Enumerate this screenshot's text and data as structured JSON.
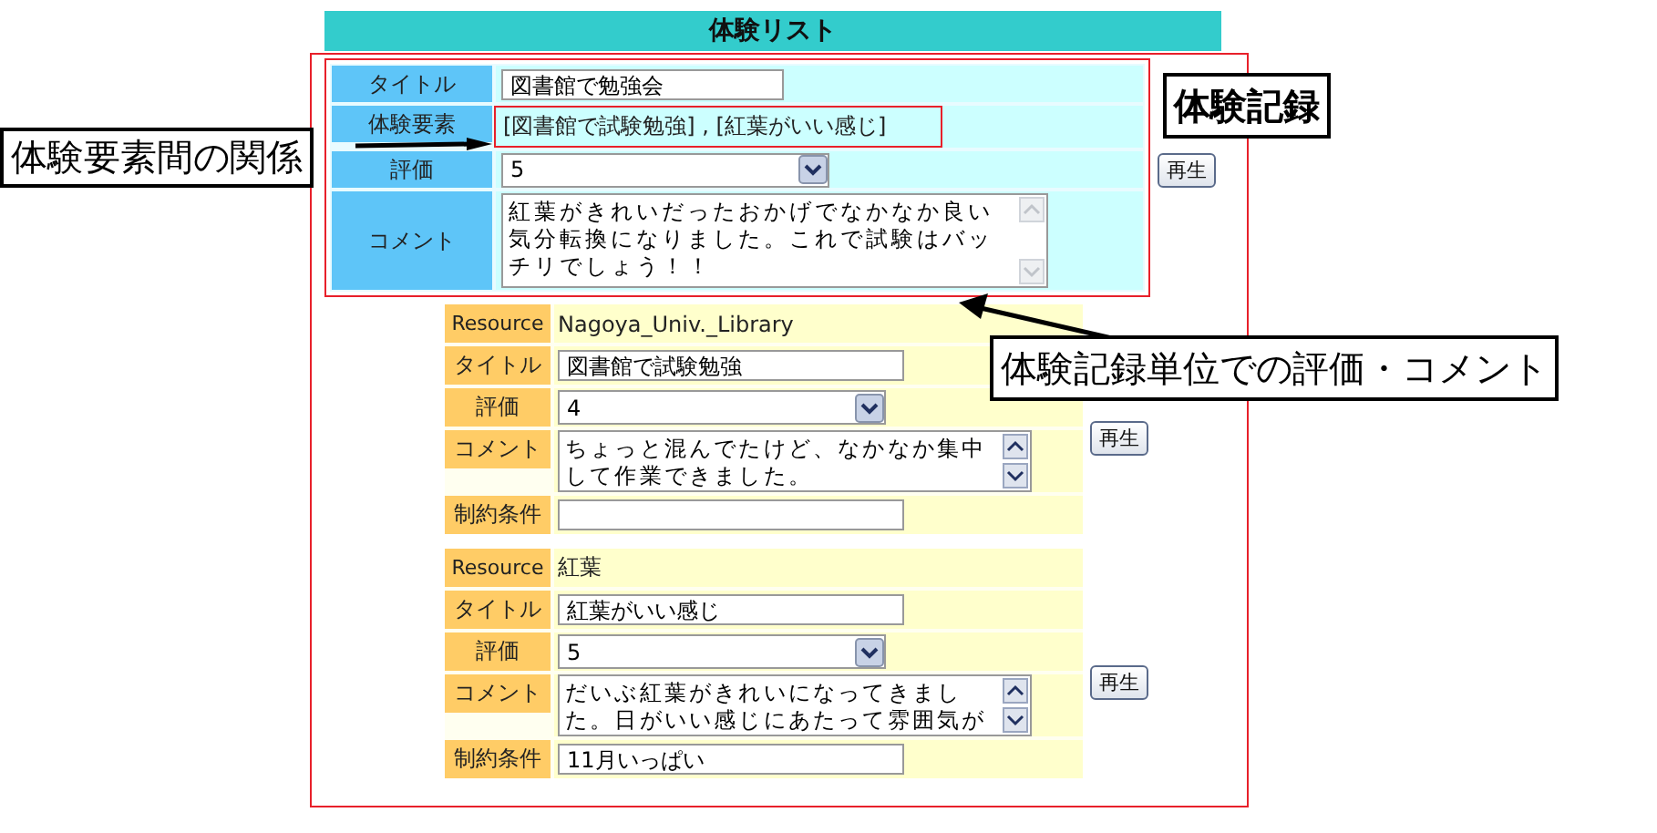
{
  "header": {
    "title": "体験リスト"
  },
  "record": {
    "fields": [
      {
        "kind": "input",
        "label": "タイトル",
        "value": "図書館で勉強会"
      },
      {
        "kind": "text",
        "label": "体験要素",
        "value": "[図書館で試験勉強] , [紅葉がいい感じ]"
      },
      {
        "kind": "select",
        "label": "評価",
        "value": "5"
      },
      {
        "kind": "textarea",
        "label": "コメント",
        "value": "紅葉がきれいだったおかげでなかなか良い気分転換になりました。これで試験はバッチリでしょう！！"
      }
    ],
    "play_button": "再生"
  },
  "resources": [
    {
      "fields": [
        {
          "kind": "text",
          "label": "Resource",
          "value": "Nagoya_Univ._Library"
        },
        {
          "kind": "input",
          "label": "タイトル",
          "value": "図書館で試験勉強"
        },
        {
          "kind": "select",
          "label": "評価",
          "value": "4"
        },
        {
          "kind": "textarea",
          "label": "コメント",
          "value": "ちょっと混んでたけど、なかなか集中して作業できました。"
        },
        {
          "kind": "input",
          "label": "制約条件"
        }
      ],
      "play_button": "再生"
    },
    {
      "fields": [
        {
          "kind": "text",
          "label": "Resource",
          "value": "紅葉"
        },
        {
          "kind": "input",
          "label": "タイトル",
          "value": "紅葉がいい感じ"
        },
        {
          "kind": "select",
          "label": "評価",
          "value": "5"
        },
        {
          "kind": "textarea",
          "label": "コメント",
          "value": "だいぶ紅葉がきれいになってきました。日がいい感じにあたって雰囲気が"
        },
        {
          "kind": "input",
          "label": "制約条件",
          "value": "11月いっぱい"
        }
      ],
      "play_button": "再生"
    }
  ],
  "annotations": [
    {
      "kind": "label",
      "text": "体験記録"
    },
    {
      "kind": "arrow-label",
      "text": "体験要素間の関係"
    },
    {
      "kind": "arrow-label",
      "text": "体験記録単位での評価・コメント"
    }
  ]
}
